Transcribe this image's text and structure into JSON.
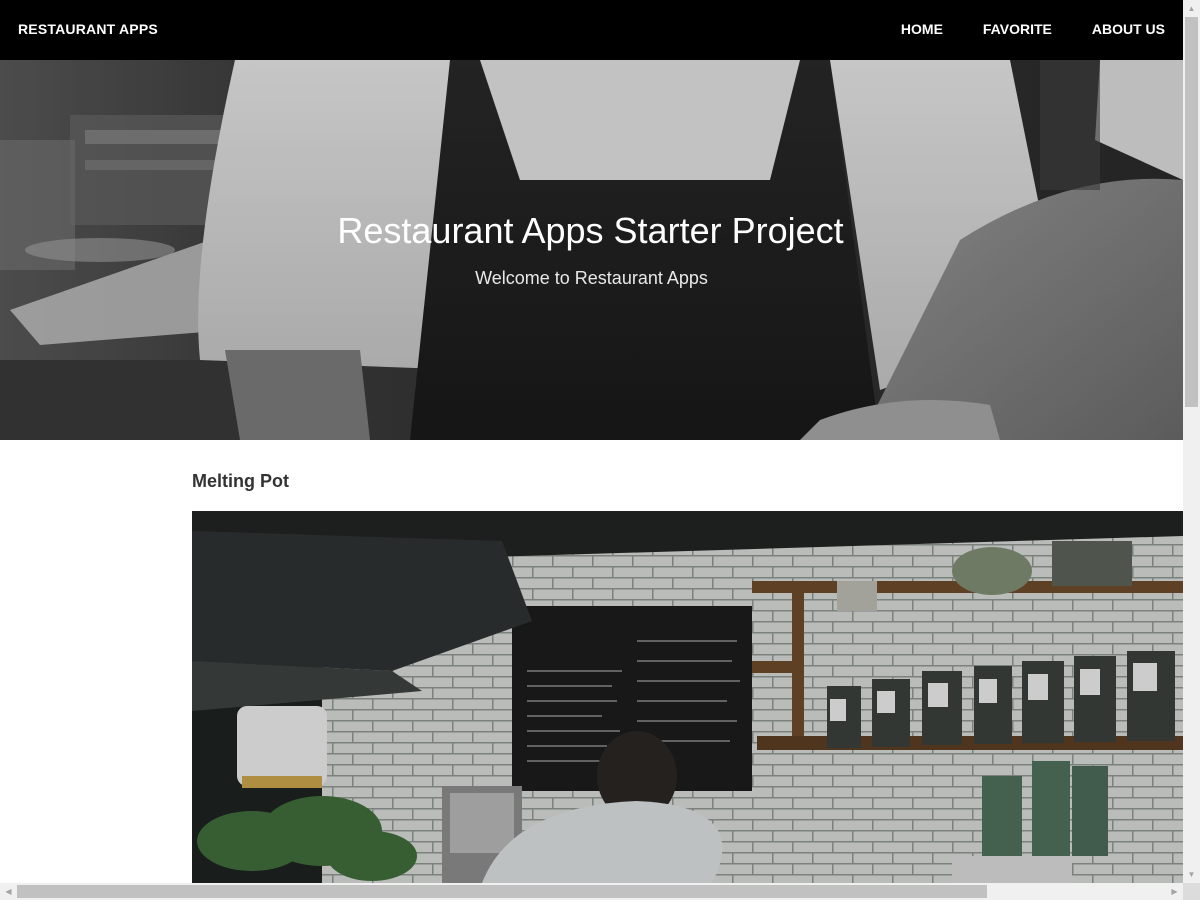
{
  "app_bar": {
    "brand": "RESTAURANT APPS",
    "nav_items": [
      {
        "label": "HOME"
      },
      {
        "label": "FAVORITE"
      },
      {
        "label": "ABOUT US"
      }
    ]
  },
  "hero": {
    "title": "Restaurant Apps Starter Project",
    "subtitle": "Welcome to Restaurant Apps"
  },
  "content": {
    "restaurant_name": "Melting Pot",
    "image_icon": "restaurant-photo"
  },
  "scrollbars": {
    "up_arrow": "▲",
    "down_arrow": "▼",
    "left_arrow": "◀",
    "right_arrow": "▶"
  },
  "colors": {
    "app_bar_bg": "#000000",
    "app_bar_text": "#ffffff",
    "hero_overlay_text": "#ffffff",
    "title_text": "#333333"
  }
}
